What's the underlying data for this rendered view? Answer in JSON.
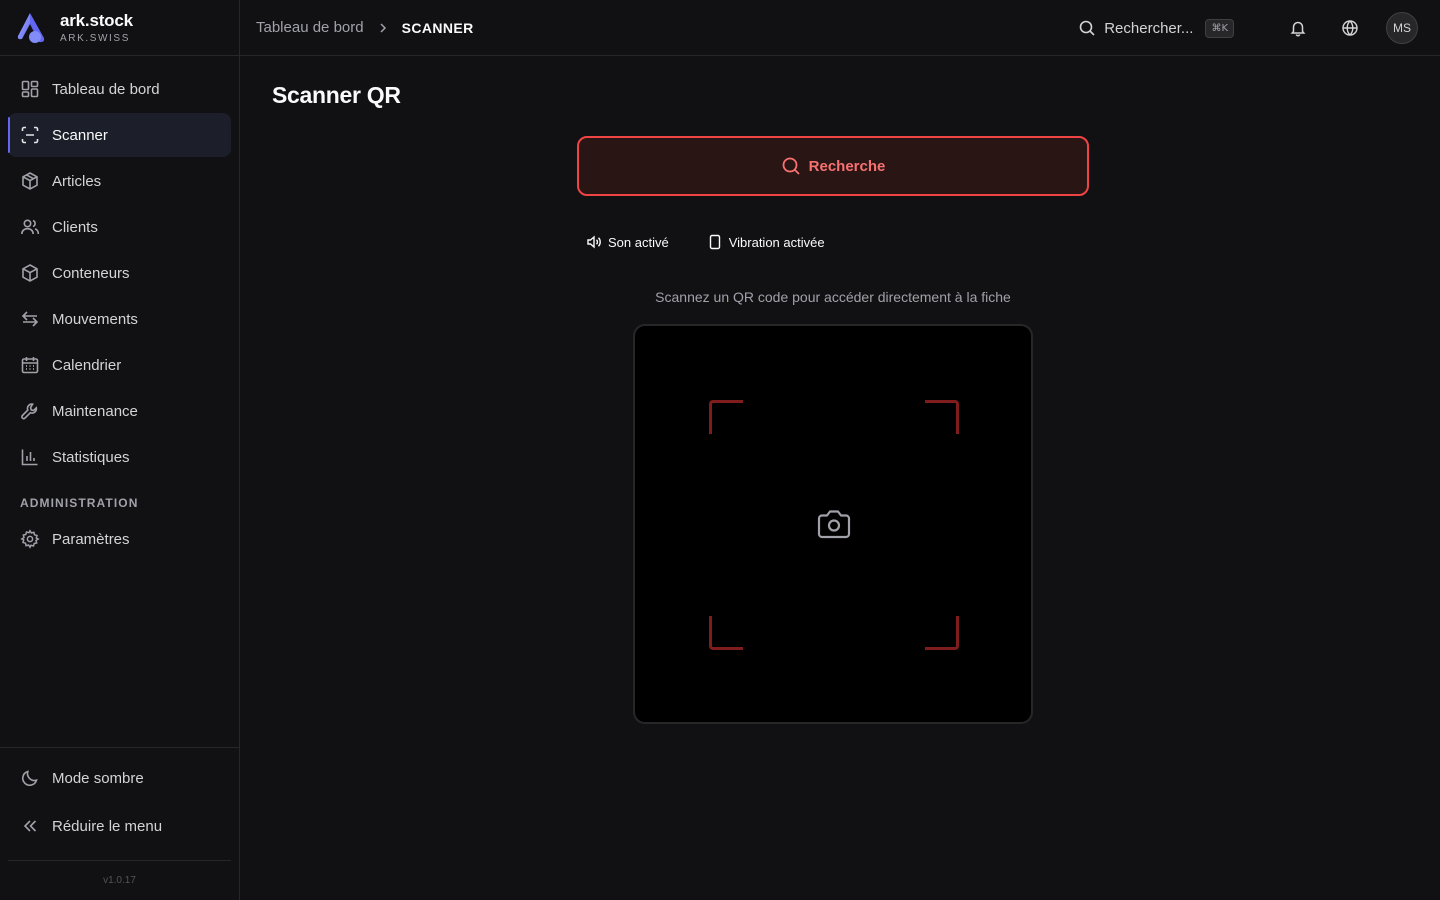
{
  "app": {
    "name": "ark.stock",
    "subtitle": "ARK.SWISS",
    "accent_color": "#6366f1",
    "danger_color": "#ef4444"
  },
  "sidebar": {
    "items": [
      {
        "label": "Tableau de bord",
        "icon": "layout-grid-icon",
        "active": false
      },
      {
        "label": "Scanner",
        "icon": "scan-icon",
        "active": true
      },
      {
        "label": "Articles",
        "icon": "package-icon",
        "active": false
      },
      {
        "label": "Clients",
        "icon": "users-icon",
        "active": false
      },
      {
        "label": "Conteneurs",
        "icon": "box-icon",
        "active": false
      },
      {
        "label": "Mouvements",
        "icon": "arrows-left-right-icon",
        "active": false
      },
      {
        "label": "Calendrier",
        "icon": "calendar-icon",
        "active": false
      },
      {
        "label": "Maintenance",
        "icon": "wrench-icon",
        "active": false
      },
      {
        "label": "Statistiques",
        "icon": "bar-chart-icon",
        "active": false
      }
    ],
    "section_label": "ADMINISTRATION",
    "admin_items": [
      {
        "label": "Paramètres",
        "icon": "gear-icon"
      }
    ],
    "dark_mode_label": "Mode sombre",
    "collapse_label": "Réduire le menu",
    "version": "v1.0.17"
  },
  "header": {
    "breadcrumb": {
      "parent": "Tableau de bord",
      "current": "SCANNER"
    },
    "search_label": "Rechercher...",
    "search_shortcut": "⌘K",
    "avatar_initials": "MS"
  },
  "main": {
    "title": "Scanner QR",
    "search_button_label": "Recherche",
    "sound_toggle_label": "Son activé",
    "vibration_toggle_label": "Vibration activée",
    "hint": "Scannez un QR code pour accéder directement à la fiche"
  }
}
